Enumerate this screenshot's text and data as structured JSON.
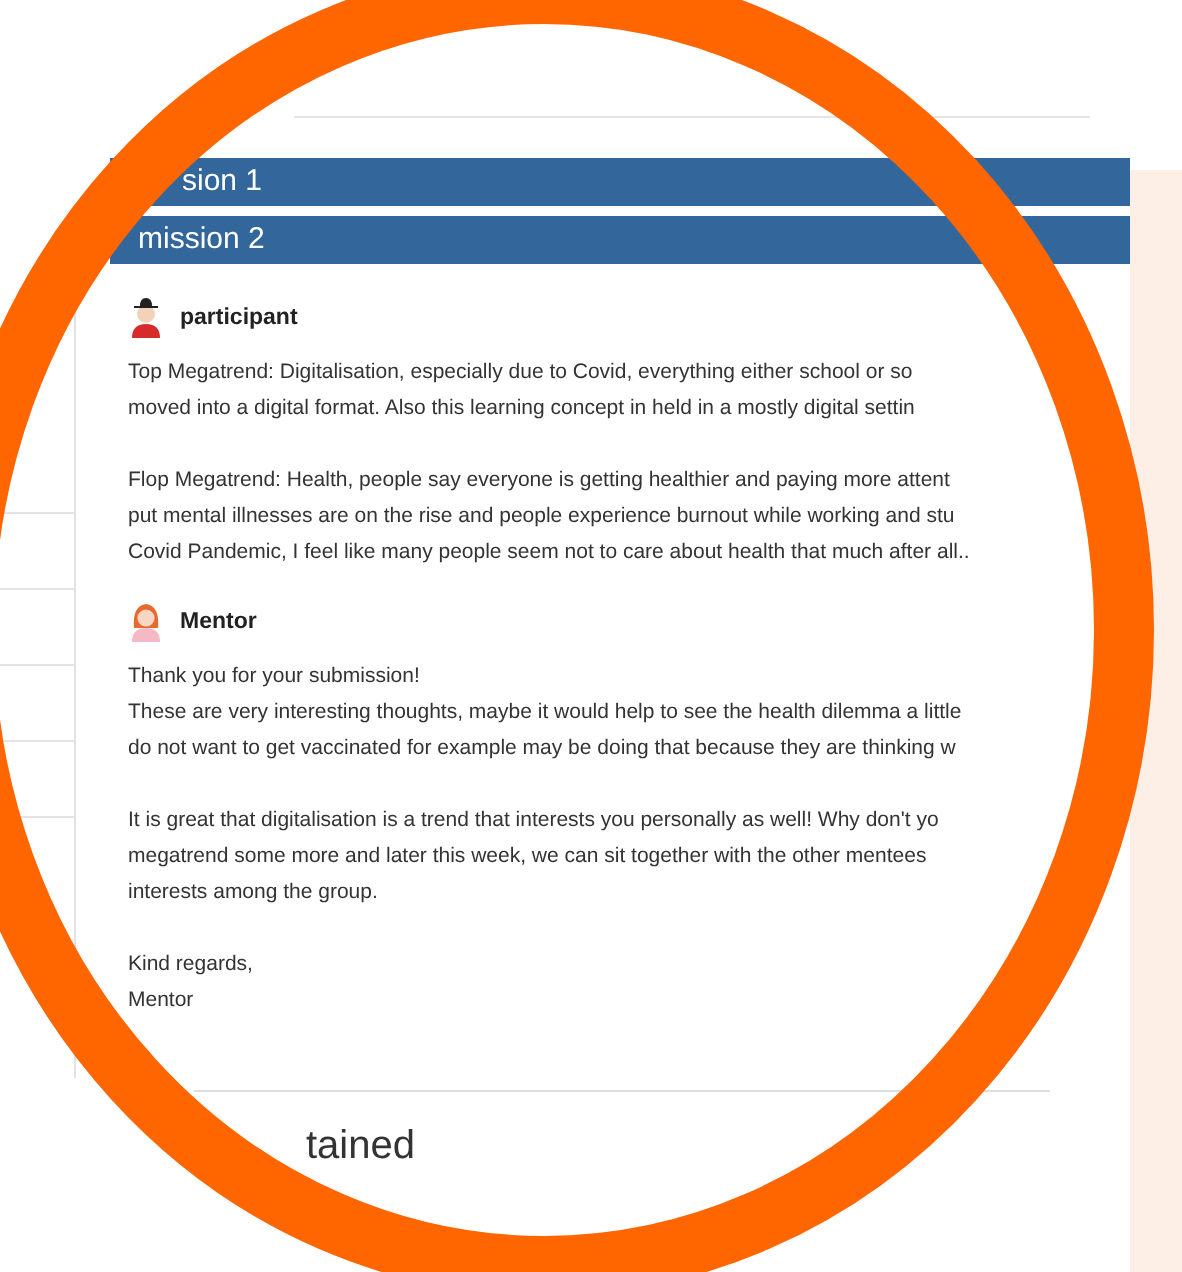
{
  "submissions": [
    {
      "title": "sion 1"
    },
    {
      "title": "mission 2"
    }
  ],
  "messages": [
    {
      "kind": "participant",
      "author": "participant",
      "paragraphs": [
        [
          "Top Megatrend: Digitalisation, especially due to Covid, everything either school or so",
          "moved into a digital format. Also this learning concept in held in a mostly digital settin"
        ],
        [
          "Flop Megatrend: Health, people say everyone is getting healthier and paying more attent",
          "put mental illnesses are on the rise and people experience burnout while working and stu",
          "Covid Pandemic, I feel like many people seem not to care about health that much after all.."
        ]
      ]
    },
    {
      "kind": "mentor",
      "author": "Mentor",
      "paragraphs": [
        [
          "Thank you for your submission!",
          "These are very interesting thoughts, maybe it would help to see the health dilemma a little",
          "do not want to get vaccinated for example may be doing that because they are thinking w"
        ],
        [
          "It is great that digitalisation is a trend that interests you personally as well! Why don't yo",
          "megatrend some more and later this week, we can sit together with the other mentees",
          "interests among the group."
        ],
        [
          "Kind regards,",
          "Mentor"
        ]
      ]
    }
  ],
  "section_heading": "tained"
}
